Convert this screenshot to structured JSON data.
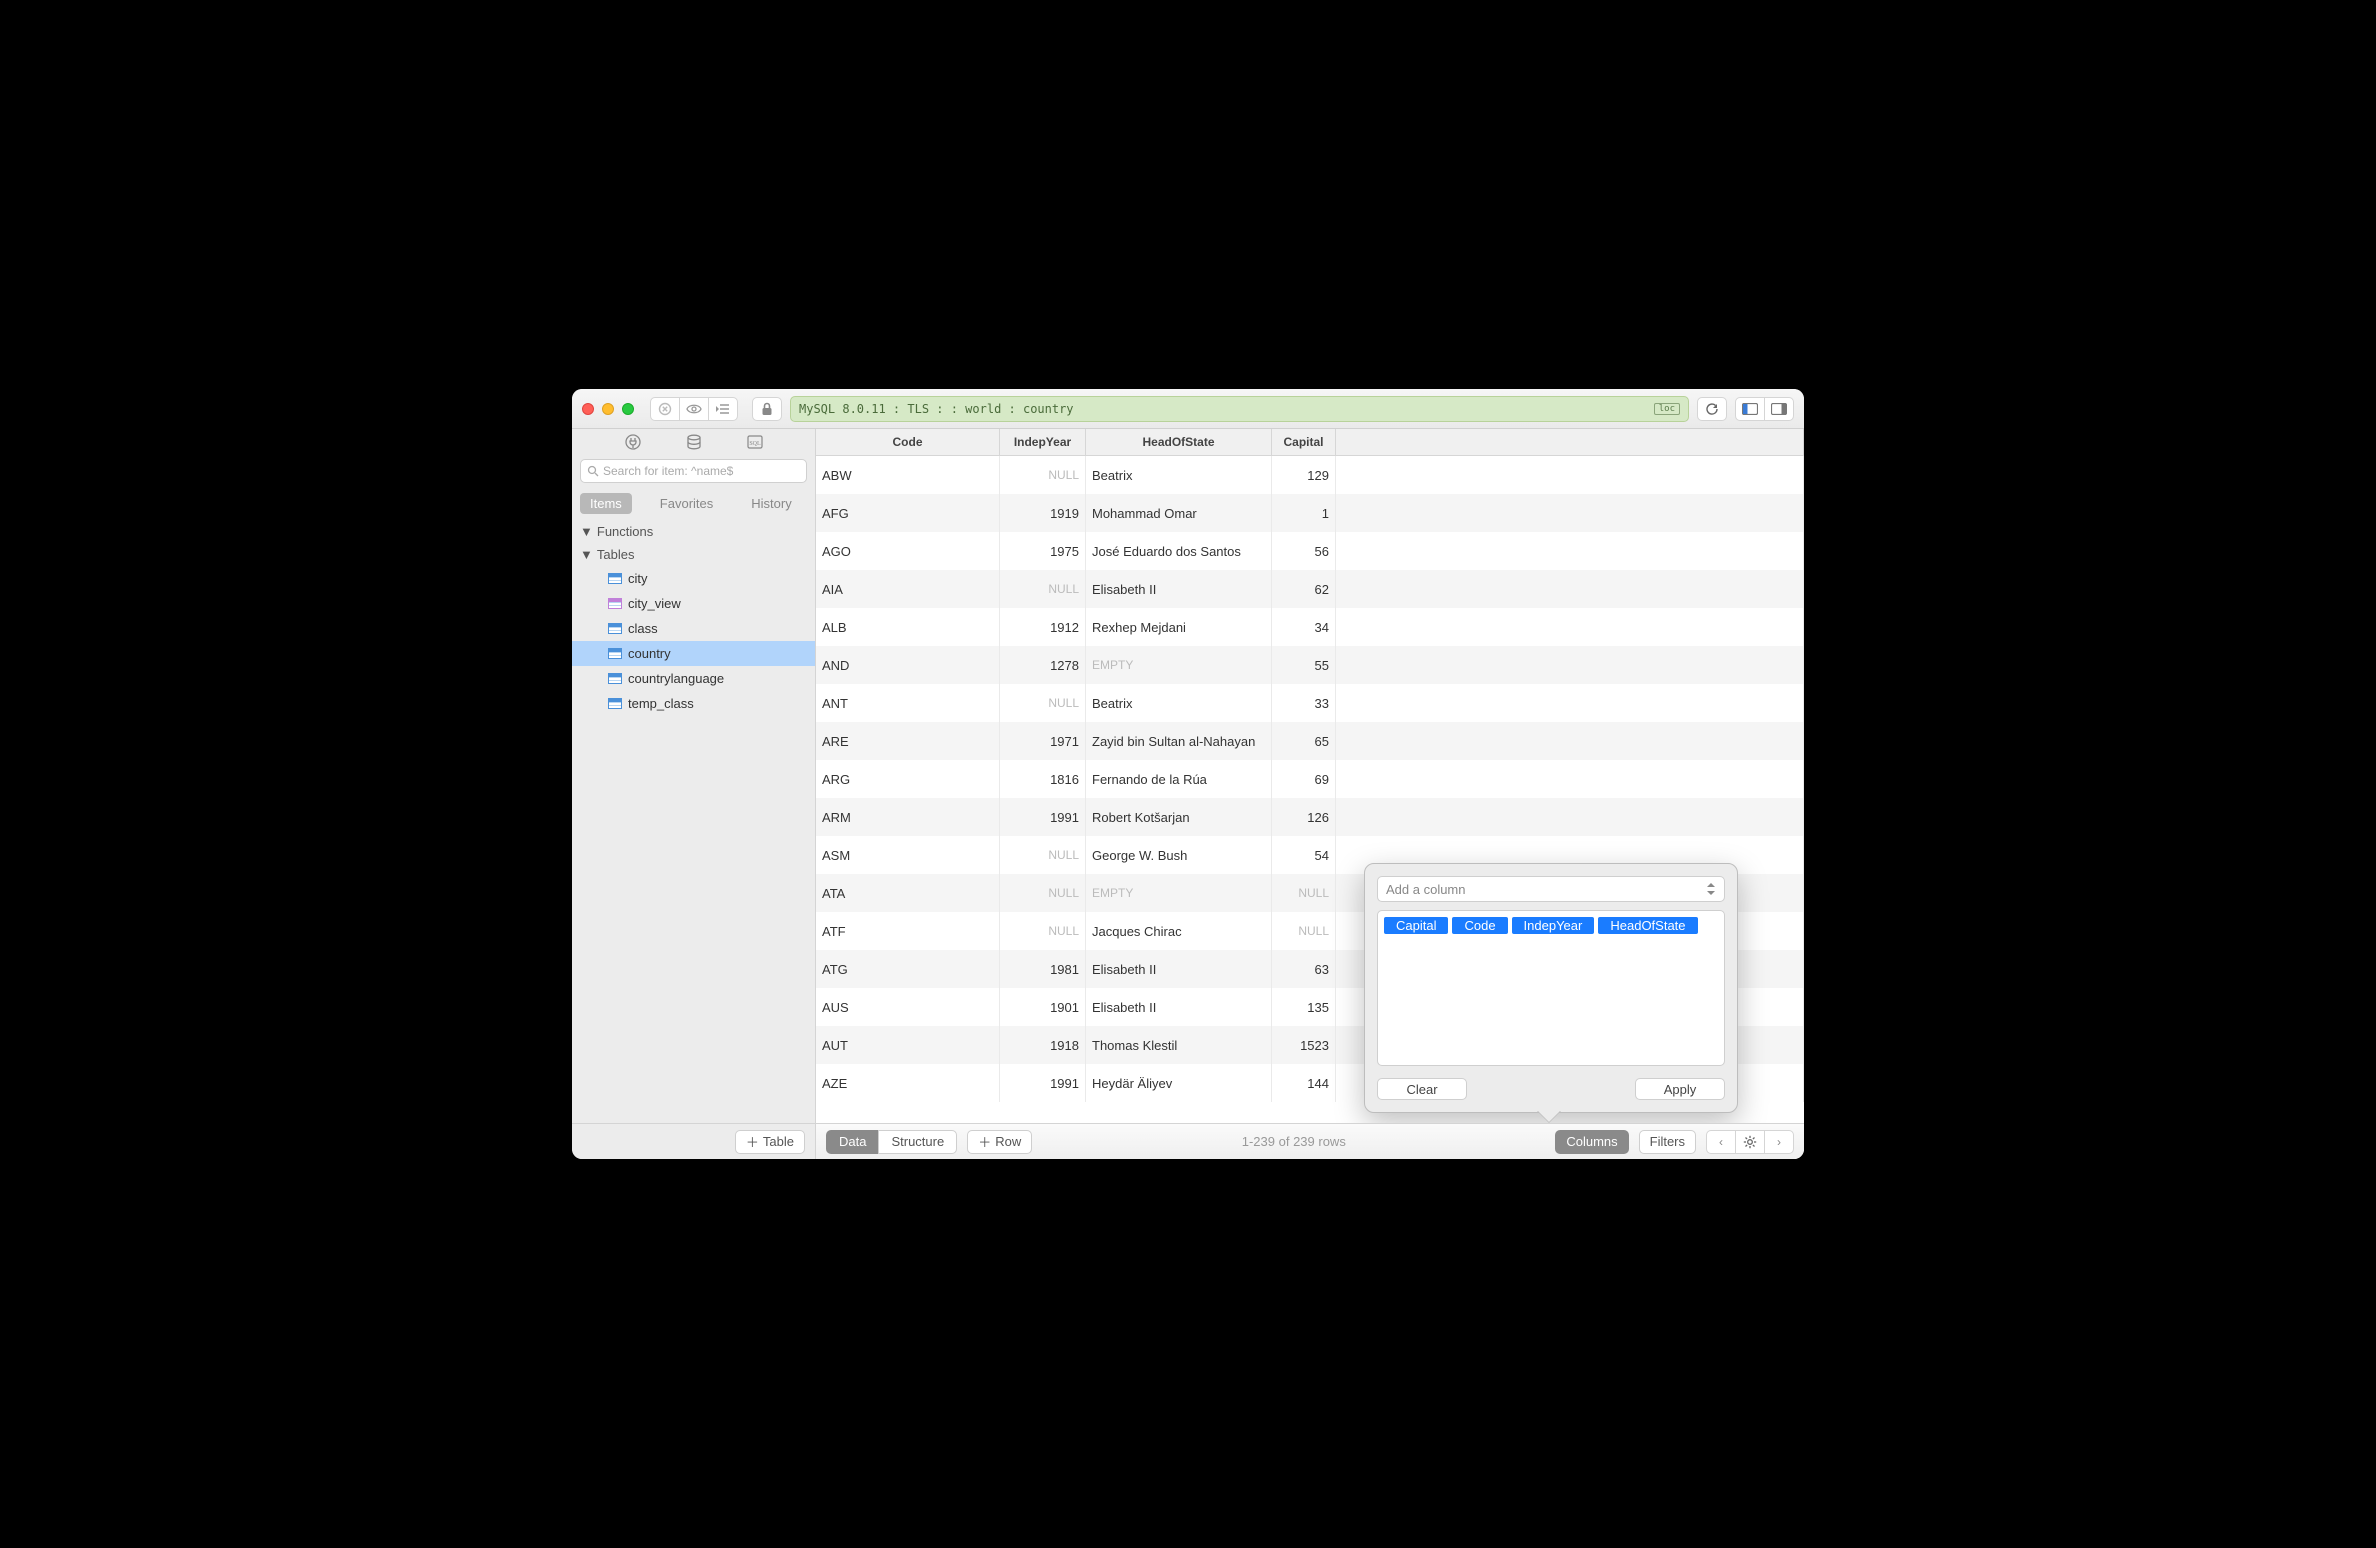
{
  "pathbar": {
    "text": "MySQL 8.0.11 : TLS :  : world : country",
    "loc_badge": "loc"
  },
  "sidebar": {
    "search_placeholder": "Search for item: ^name$",
    "tabs": [
      {
        "label": "Items",
        "active": true
      },
      {
        "label": "Favorites",
        "active": false
      },
      {
        "label": "History",
        "active": false
      }
    ],
    "sections": {
      "functions_label": "Functions",
      "tables_label": "Tables",
      "tables": [
        {
          "name": "city",
          "kind": "table"
        },
        {
          "name": "city_view",
          "kind": "view"
        },
        {
          "name": "class",
          "kind": "table"
        },
        {
          "name": "country",
          "kind": "table",
          "selected": true
        },
        {
          "name": "countrylanguage",
          "kind": "table"
        },
        {
          "name": "temp_class",
          "kind": "table"
        }
      ]
    },
    "add_table_label": "Table"
  },
  "grid": {
    "columns": [
      "Code",
      "IndepYear",
      "HeadOfState",
      "Capital"
    ],
    "rows": [
      {
        "code": "ABW",
        "indep": null,
        "head": "Beatrix",
        "cap": "129"
      },
      {
        "code": "AFG",
        "indep": "1919",
        "head": "Mohammad Omar",
        "cap": "1"
      },
      {
        "code": "AGO",
        "indep": "1975",
        "head": "José Eduardo dos Santos",
        "cap": "56"
      },
      {
        "code": "AIA",
        "indep": null,
        "head": "Elisabeth II",
        "cap": "62"
      },
      {
        "code": "ALB",
        "indep": "1912",
        "head": "Rexhep Mejdani",
        "cap": "34"
      },
      {
        "code": "AND",
        "indep": "1278",
        "head": "",
        "cap": "55"
      },
      {
        "code": "ANT",
        "indep": null,
        "head": "Beatrix",
        "cap": "33"
      },
      {
        "code": "ARE",
        "indep": "1971",
        "head": "Zayid bin Sultan al-Nahayan",
        "cap": "65"
      },
      {
        "code": "ARG",
        "indep": "1816",
        "head": "Fernando de la Rúa",
        "cap": "69"
      },
      {
        "code": "ARM",
        "indep": "1991",
        "head": "Robert Kotšarjan",
        "cap": "126"
      },
      {
        "code": "ASM",
        "indep": null,
        "head": "George W. Bush",
        "cap": "54"
      },
      {
        "code": "ATA",
        "indep": null,
        "head": "",
        "cap": null
      },
      {
        "code": "ATF",
        "indep": null,
        "head": "Jacques Chirac",
        "cap": null
      },
      {
        "code": "ATG",
        "indep": "1981",
        "head": "Elisabeth II",
        "cap": "63"
      },
      {
        "code": "AUS",
        "indep": "1901",
        "head": "Elisabeth II",
        "cap": "135"
      },
      {
        "code": "AUT",
        "indep": "1918",
        "head": "Thomas Klestil",
        "cap": "1523"
      },
      {
        "code": "AZE",
        "indep": "1991",
        "head": "Heydär Äliyev",
        "cap": "144"
      }
    ],
    "null_label": "NULL",
    "empty_label": "EMPTY"
  },
  "bottombar": {
    "segments": [
      {
        "label": "Data",
        "active": true
      },
      {
        "label": "Structure",
        "active": false
      }
    ],
    "add_row_label": "Row",
    "status": "1-239 of 239 rows",
    "columns_btn": "Columns",
    "filters_btn": "Filters"
  },
  "popover": {
    "placeholder": "Add a column",
    "tokens": [
      "Capital",
      "Code",
      "IndepYear",
      "HeadOfState"
    ],
    "clear_label": "Clear",
    "apply_label": "Apply"
  }
}
